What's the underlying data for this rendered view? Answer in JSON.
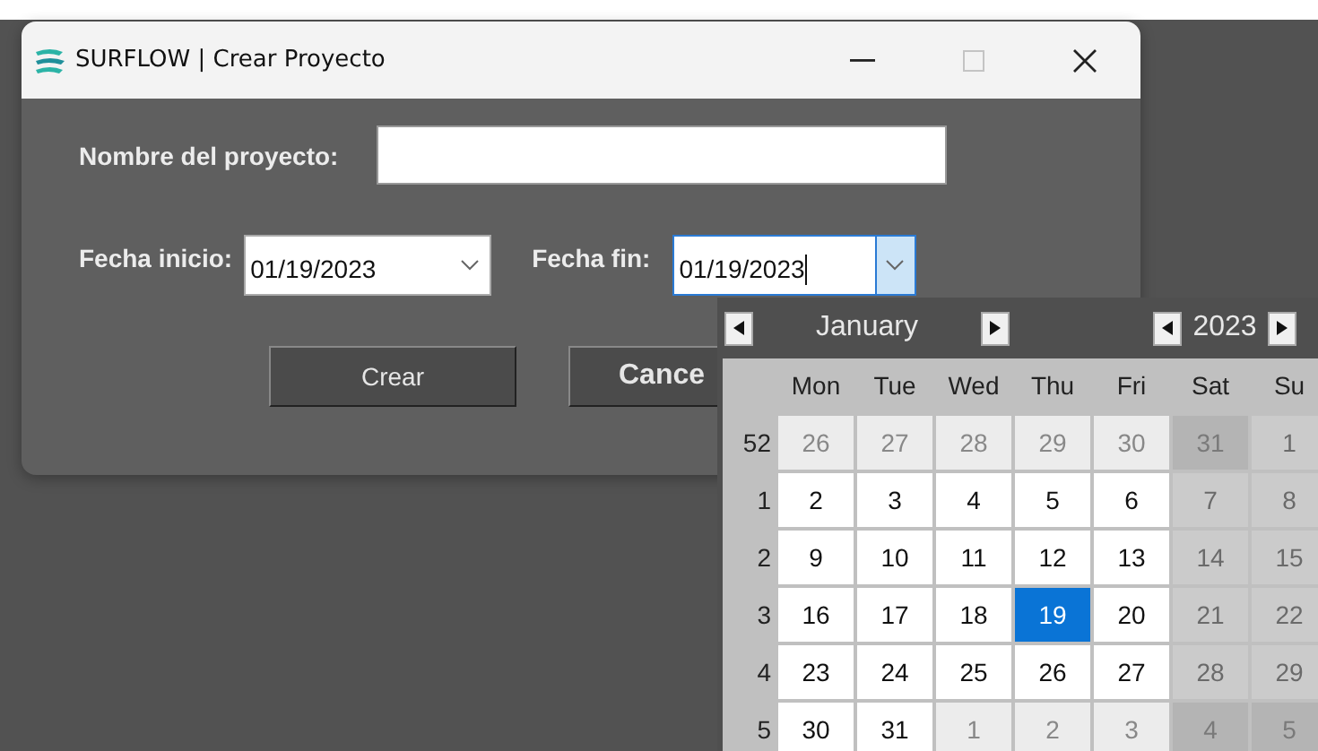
{
  "window": {
    "title": "SURFLOW | Crear Proyecto",
    "maximize_disabled": true
  },
  "project_name": {
    "label": "Nombre del proyecto:"
  },
  "start_date": {
    "label": "Fecha inicio:",
    "value": "01/19/2023",
    "focused": false,
    "expanded": false
  },
  "end_date": {
    "label": "Fecha fin:",
    "value": "01/19/2023",
    "focused": true,
    "expanded": true
  },
  "buttons": [
    {
      "label": "Crear"
    },
    {
      "label": "Cance"
    }
  ],
  "calendar": {
    "month": "January",
    "year": "2023",
    "weekdays": [
      {
        "label": "Mon",
        "weekend": false
      },
      {
        "label": "Tue",
        "weekend": false
      },
      {
        "label": "Wed",
        "weekend": false
      },
      {
        "label": "Thu",
        "weekend": false
      },
      {
        "label": "Fri",
        "weekend": false
      },
      {
        "label": "Sat",
        "weekend": true
      },
      {
        "label": "Su",
        "weekend": true
      }
    ],
    "weeks": [
      {
        "week": "52",
        "days": [
          {
            "text": "26",
            "other_month": true,
            "selected": false
          },
          {
            "text": "27",
            "other_month": true,
            "selected": false
          },
          {
            "text": "28",
            "other_month": true,
            "selected": false
          },
          {
            "text": "29",
            "other_month": true,
            "selected": false
          },
          {
            "text": "30",
            "other_month": true,
            "selected": false
          },
          {
            "text": "31",
            "other_month": true,
            "selected": false
          },
          {
            "text": "1",
            "other_month": false,
            "selected": false
          }
        ]
      },
      {
        "week": "1",
        "days": [
          {
            "text": "2",
            "other_month": false,
            "selected": false
          },
          {
            "text": "3",
            "other_month": false,
            "selected": false
          },
          {
            "text": "4",
            "other_month": false,
            "selected": false
          },
          {
            "text": "5",
            "other_month": false,
            "selected": false
          },
          {
            "text": "6",
            "other_month": false,
            "selected": false
          },
          {
            "text": "7",
            "other_month": false,
            "selected": false
          },
          {
            "text": "8",
            "other_month": false,
            "selected": false
          }
        ]
      },
      {
        "week": "2",
        "days": [
          {
            "text": "9",
            "other_month": false,
            "selected": false
          },
          {
            "text": "10",
            "other_month": false,
            "selected": false
          },
          {
            "text": "11",
            "other_month": false,
            "selected": false
          },
          {
            "text": "12",
            "other_month": false,
            "selected": false
          },
          {
            "text": "13",
            "other_month": false,
            "selected": false
          },
          {
            "text": "14",
            "other_month": false,
            "selected": false
          },
          {
            "text": "15",
            "other_month": false,
            "selected": false
          }
        ]
      },
      {
        "week": "3",
        "days": [
          {
            "text": "16",
            "other_month": false,
            "selected": false
          },
          {
            "text": "17",
            "other_month": false,
            "selected": false
          },
          {
            "text": "18",
            "other_month": false,
            "selected": false
          },
          {
            "text": "19",
            "other_month": false,
            "selected": true
          },
          {
            "text": "20",
            "other_month": false,
            "selected": false
          },
          {
            "text": "21",
            "other_month": false,
            "selected": false
          },
          {
            "text": "22",
            "other_month": false,
            "selected": false
          }
        ]
      },
      {
        "week": "4",
        "days": [
          {
            "text": "23",
            "other_month": false,
            "selected": false
          },
          {
            "text": "24",
            "other_month": false,
            "selected": false
          },
          {
            "text": "25",
            "other_month": false,
            "selected": false
          },
          {
            "text": "26",
            "other_month": false,
            "selected": false
          },
          {
            "text": "27",
            "other_month": false,
            "selected": false
          },
          {
            "text": "28",
            "other_month": false,
            "selected": false
          },
          {
            "text": "29",
            "other_month": false,
            "selected": false
          }
        ]
      },
      {
        "week": "5",
        "days": [
          {
            "text": "30",
            "other_month": false,
            "selected": false
          },
          {
            "text": "31",
            "other_month": false,
            "selected": false
          },
          {
            "text": "1",
            "other_month": true,
            "selected": false
          },
          {
            "text": "2",
            "other_month": true,
            "selected": false
          },
          {
            "text": "3",
            "other_month": true,
            "selected": false
          },
          {
            "text": "4",
            "other_month": true,
            "selected": false
          },
          {
            "text": "5",
            "other_month": true,
            "selected": false
          }
        ]
      }
    ]
  }
}
